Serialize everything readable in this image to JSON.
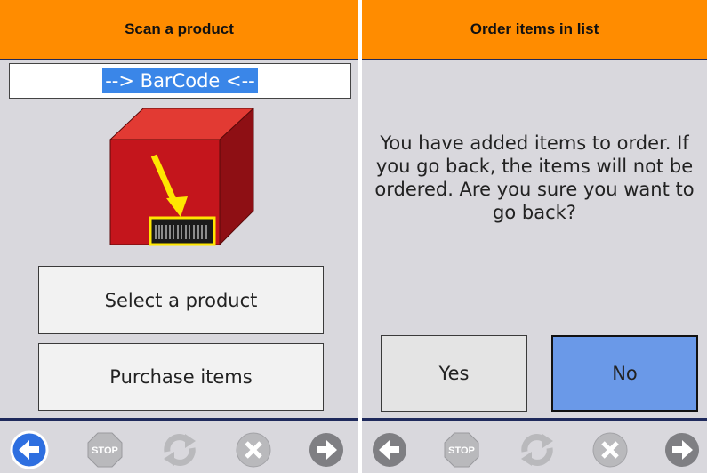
{
  "left": {
    "header": {
      "title": "Scan a product"
    },
    "barcode_field": {
      "value": "--> BarCode <--"
    },
    "buttons": {
      "select_product": "Select a product",
      "purchase_items": "Purchase items"
    }
  },
  "right": {
    "header": {
      "title": "Order items in list"
    },
    "message": "You have added items to order. If you go back, the items will not be ordered. Are you sure you want to go back?",
    "buttons": {
      "yes": "Yes",
      "no": "No"
    }
  },
  "toolbar_icons": [
    "back-arrow-icon",
    "stop-icon",
    "refresh-icon",
    "close-circle-icon",
    "forward-arrow-icon"
  ],
  "icon_labels": {
    "stop": "STOP"
  },
  "colors": {
    "header": "#ff8c00",
    "panel_background": "#d9d8dd",
    "active_back": "#2e6fe0",
    "no_button": "#6a99e8",
    "selection": "#3a86e8",
    "product_box": "#c4151c",
    "arrow": "#ffe600"
  }
}
